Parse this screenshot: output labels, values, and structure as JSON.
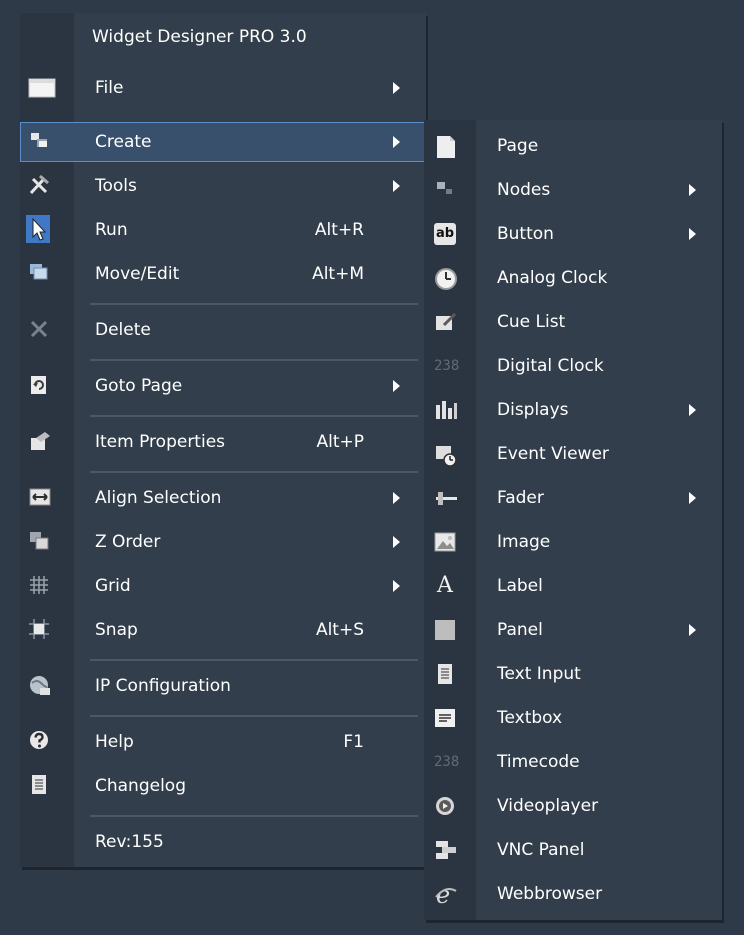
{
  "main_menu": {
    "title": "Widget Designer PRO 3.0",
    "items": [
      {
        "label": "File",
        "icon": "window-icon",
        "submenu": true
      },
      {
        "label": "Create",
        "icon": "create-widgets-icon",
        "submenu": true,
        "highlighted": true
      },
      {
        "label": "Tools",
        "icon": "tools-icon",
        "submenu": true
      },
      {
        "label": "Run",
        "icon": "cursor-arrow-icon",
        "shortcut": "Alt+R"
      },
      {
        "label": "Move/Edit",
        "icon": "move-edit-icon",
        "shortcut": "Alt+M"
      },
      {
        "label": "Delete",
        "icon": "delete-x-icon"
      },
      {
        "label": "Goto Page",
        "icon": "goto-page-icon",
        "submenu": true
      },
      {
        "label": "Item Properties",
        "icon": "item-properties-icon",
        "shortcut": "Alt+P"
      },
      {
        "label": "Align Selection",
        "icon": "align-selection-icon",
        "submenu": true
      },
      {
        "label": "Z Order",
        "icon": "z-order-icon",
        "submenu": true
      },
      {
        "label": "Grid",
        "icon": "grid-icon",
        "submenu": true
      },
      {
        "label": "Snap",
        "icon": "snap-icon",
        "shortcut": "Alt+S"
      },
      {
        "label": "IP Configuration",
        "icon": "globe-network-icon"
      },
      {
        "label": "Help",
        "icon": "help-icon",
        "shortcut": "F1"
      },
      {
        "label": "Changelog",
        "icon": "document-icon"
      },
      {
        "label": "Rev:155"
      }
    ]
  },
  "create_submenu": {
    "items": [
      {
        "label": "Page",
        "icon": "page-icon"
      },
      {
        "label": "Nodes",
        "icon": "nodes-icon",
        "submenu": true
      },
      {
        "label": "Button",
        "icon": "button-ab-icon",
        "submenu": true
      },
      {
        "label": "Analog Clock",
        "icon": "clock-icon"
      },
      {
        "label": "Cue List",
        "icon": "cue-list-icon"
      },
      {
        "label": "Digital Clock",
        "icon": "digital-clock-icon"
      },
      {
        "label": "Displays",
        "icon": "displays-icon",
        "submenu": true
      },
      {
        "label": "Event Viewer",
        "icon": "event-viewer-icon"
      },
      {
        "label": "Fader",
        "icon": "fader-icon",
        "submenu": true
      },
      {
        "label": "Image",
        "icon": "image-icon"
      },
      {
        "label": "Label",
        "icon": "label-a-icon"
      },
      {
        "label": "Panel",
        "icon": "panel-icon",
        "submenu": true
      },
      {
        "label": "Text Input",
        "icon": "text-input-icon"
      },
      {
        "label": "Textbox",
        "icon": "textbox-icon"
      },
      {
        "label": "Timecode",
        "icon": "timecode-icon"
      },
      {
        "label": "Videoplayer",
        "icon": "videoplayer-icon"
      },
      {
        "label": "VNC Panel",
        "icon": "vnc-panel-icon"
      },
      {
        "label": "Webbrowser",
        "icon": "webbrowser-icon"
      }
    ]
  },
  "digital_clock_glyph": "238",
  "label_icon_glyph": "A",
  "button_icon_glyph": "ab",
  "colors": {
    "background": "#2e3a47",
    "menu": "#323e4b",
    "highlight_border": "#5b8fcb",
    "highlight_fill": "#38506b"
  }
}
